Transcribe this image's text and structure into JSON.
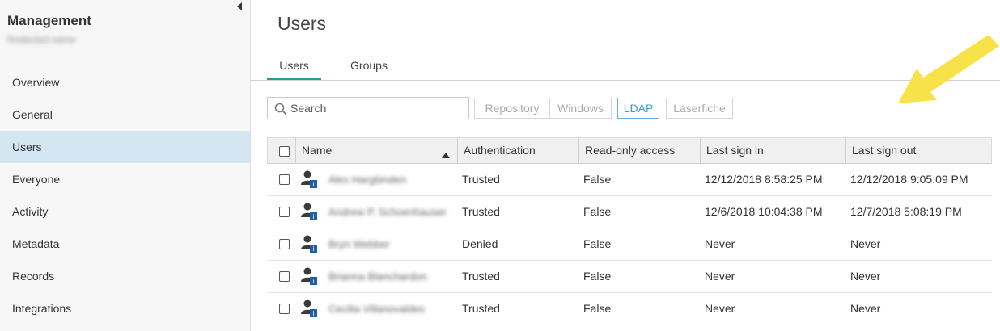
{
  "sidebar": {
    "title": "Management",
    "subtitle": "Redacted name",
    "collapse_icon": "triangle-left-icon",
    "items": [
      {
        "label": "Overview",
        "active": false
      },
      {
        "label": "General",
        "active": false
      },
      {
        "label": "Users",
        "active": true
      },
      {
        "label": "Everyone",
        "active": false
      },
      {
        "label": "Activity",
        "active": false
      },
      {
        "label": "Metadata",
        "active": false
      },
      {
        "label": "Records",
        "active": false
      },
      {
        "label": "Integrations",
        "active": false
      }
    ]
  },
  "main": {
    "title": "Users",
    "tabs": [
      {
        "label": "Users",
        "active": true
      },
      {
        "label": "Groups",
        "active": false
      }
    ],
    "search": {
      "placeholder": "Search",
      "value": ""
    },
    "filters": [
      {
        "label": "Repository",
        "active": false
      },
      {
        "label": "Windows",
        "active": false
      },
      {
        "label": "LDAP",
        "active": true
      },
      {
        "label": "Laserfiche",
        "active": false
      }
    ],
    "annotation_color": "#f7e24a",
    "accent_color": "#2e9a8a"
  },
  "table": {
    "columns": [
      "Name",
      "Authentication",
      "Read-only access",
      "Last sign in",
      "Last sign out"
    ],
    "sort": {
      "column": "Name",
      "direction": "ascending"
    },
    "rows": [
      {
        "name": "Alex Hargbinden",
        "authentication": "Trusted",
        "read_only": "False",
        "last_sign_in": "12/12/2018 8:58:25 PM",
        "last_sign_out": "12/12/2018 9:05:09 PM"
      },
      {
        "name": "Andrew P. Schoenhauser",
        "authentication": "Trusted",
        "read_only": "False",
        "last_sign_in": "12/6/2018 10:04:38 PM",
        "last_sign_out": "12/7/2018 5:08:19 PM"
      },
      {
        "name": "Bryn Webber",
        "authentication": "Denied",
        "read_only": "False",
        "last_sign_in": "Never",
        "last_sign_out": "Never"
      },
      {
        "name": "Brianna Blanchardon",
        "authentication": "Trusted",
        "read_only": "False",
        "last_sign_in": "Never",
        "last_sign_out": "Never"
      },
      {
        "name": "Cecilia Villanovaldes",
        "authentication": "Trusted",
        "read_only": "False",
        "last_sign_in": "Never",
        "last_sign_out": "Never"
      }
    ]
  }
}
